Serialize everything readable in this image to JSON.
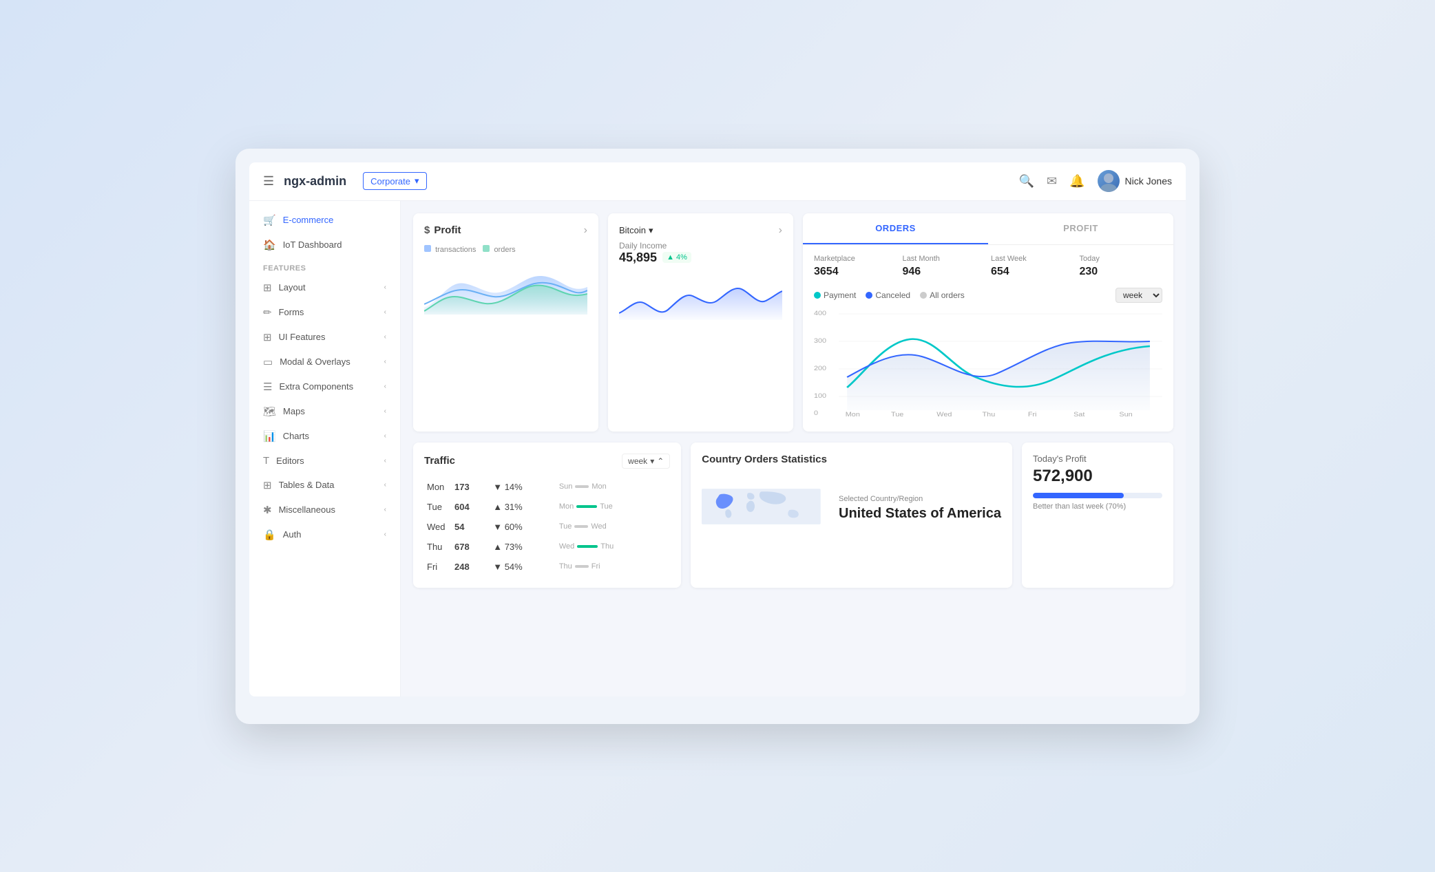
{
  "app": {
    "brand": "ngx-admin",
    "theme_label": "Corporate",
    "hamburger": "☰"
  },
  "header": {
    "search_icon": "🔍",
    "mail_icon": "✉",
    "bell_icon": "🔔",
    "user_name": "Nick Jones"
  },
  "sidebar": {
    "active_item": "E-commerce",
    "items": [
      {
        "id": "ecommerce",
        "label": "E-commerce",
        "icon": "🛒",
        "active": true
      },
      {
        "id": "iot",
        "label": "IoT Dashboard",
        "icon": "🏠",
        "active": false
      }
    ],
    "features_label": "FEATURES",
    "feature_items": [
      {
        "id": "layout",
        "label": "Layout",
        "has_arrow": true
      },
      {
        "id": "forms",
        "label": "Forms",
        "has_arrow": true
      },
      {
        "id": "ui-features",
        "label": "UI Features",
        "has_arrow": true
      },
      {
        "id": "modal",
        "label": "Modal & Overlays",
        "has_arrow": true
      },
      {
        "id": "extra",
        "label": "Extra Components",
        "has_arrow": true
      },
      {
        "id": "maps",
        "label": "Maps",
        "has_arrow": true
      },
      {
        "id": "charts",
        "label": "Charts",
        "has_arrow": true
      },
      {
        "id": "editors",
        "label": "Editors",
        "has_arrow": true
      },
      {
        "id": "tables",
        "label": "Tables & Data",
        "has_arrow": true
      },
      {
        "id": "misc",
        "label": "Miscellaneous",
        "has_arrow": true
      },
      {
        "id": "auth",
        "label": "Auth",
        "has_arrow": true
      }
    ]
  },
  "profit_card": {
    "title": "Profit",
    "currency_symbol": "$",
    "expand_icon": "›",
    "legend_transactions": "transactions",
    "legend_orders": "orders",
    "color_transactions": "#a0c4ff",
    "color_orders": "#90e0c8"
  },
  "bitcoin_card": {
    "currency": "Bitcoin",
    "expand_icon": "›",
    "daily_income_label": "Daily Income",
    "daily_income_value": "45,895",
    "pct": "4%",
    "pct_up": true
  },
  "orders_panel": {
    "tabs": [
      "ORDERS",
      "PROFIT"
    ],
    "active_tab": 0,
    "stats": [
      {
        "label": "Marketplace",
        "value": "3654"
      },
      {
        "label": "Last Month",
        "value": "946"
      },
      {
        "label": "Last Week",
        "value": "654"
      },
      {
        "label": "Today",
        "value": "230"
      }
    ],
    "legend": [
      {
        "label": "Payment",
        "color": "#00c8c8"
      },
      {
        "label": "Canceled",
        "color": "#3366ff"
      },
      {
        "label": "All orders",
        "color": "#ccc"
      }
    ],
    "period": "week",
    "chart_labels": [
      "Mon",
      "Tue",
      "Wed",
      "Thu",
      "Fri",
      "Sat",
      "Sun"
    ],
    "chart_y_labels": [
      "400",
      "300",
      "200",
      "100",
      "0"
    ]
  },
  "traffic_card": {
    "title": "Traffic",
    "period": "week",
    "rows": [
      {
        "day": "Mon",
        "value": 173,
        "pct": "14%",
        "up": false,
        "from": "Sun",
        "to": "Mon",
        "bar_color": "red"
      },
      {
        "day": "Tue",
        "value": 604,
        "pct": "31%",
        "up": true,
        "from": "Mon",
        "to": "Tue",
        "bar_color": "green"
      },
      {
        "day": "Wed",
        "value": 54,
        "pct": "60%",
        "up": false,
        "from": "Tue",
        "to": "Wed",
        "bar_color": "red"
      },
      {
        "day": "Thu",
        "value": 678,
        "pct": "73%",
        "up": true,
        "from": "Wed",
        "to": "Thu",
        "bar_color": "green"
      },
      {
        "day": "Fri",
        "value": 248,
        "pct": "54%",
        "up": false,
        "from": "Thu",
        "to": "Fri",
        "bar_color": "red"
      }
    ]
  },
  "map_card": {
    "title": "Country Orders Statistics",
    "country_region_label": "Selected Country/Region",
    "country_name": "United States of America"
  },
  "today_profit": {
    "label": "Today's Profit",
    "value": "572,900",
    "progress_pct": 70,
    "progress_note": "Better than last week (70%)"
  }
}
